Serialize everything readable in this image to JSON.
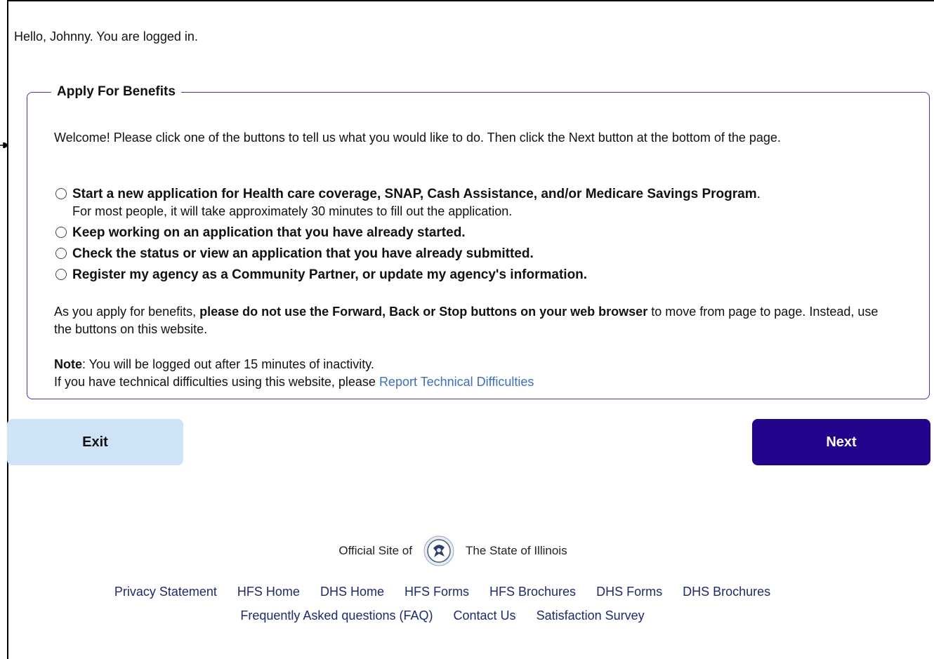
{
  "greeting": "Hello, Johnny. You are logged in.",
  "apply": {
    "legend": "Apply For Benefits",
    "welcome": "Welcome! Please click one of the buttons to tell us what you would like to do. Then click the Next button at the bottom of the page.",
    "options": [
      {
        "label": "Start a new application for Health care coverage, SNAP, Cash Assistance, and/or Medicare Savings Program",
        "suffix": ".",
        "note": "For most people, it will take approximately 30 minutes to fill out the application."
      },
      {
        "label": "Keep working on an application that you have already started."
      },
      {
        "label": "Check the status or view an application that you have already submitted."
      },
      {
        "label": "Register my agency as a Community Partner, or update my agency's information."
      }
    ],
    "warning": {
      "prefix": "As you apply for benefits, ",
      "bold": "please do not use the Forward, Back or Stop buttons on your web browser",
      "suffix": " to move from page to page. Instead, use the buttons on this website."
    },
    "note": {
      "label": "Note",
      "text": ": You will be logged out after 15 minutes of inactivity.",
      "help_prefix": "If you have technical difficulties using this website, please ",
      "help_link": "Report Technical Difficulties"
    }
  },
  "buttons": {
    "exit": "Exit",
    "next": "Next"
  },
  "footer": {
    "official_prefix": "Official Site of",
    "official_suffix": "The State of Illinois",
    "links_row1": [
      "Privacy Statement",
      "HFS Home",
      "DHS Home",
      "HFS Forms",
      "HFS Brochures",
      "DHS Forms",
      "DHS Brochures"
    ],
    "links_row2": [
      "Frequently Asked questions (FAQ)",
      "Contact Us",
      "Satisfaction Survey"
    ]
  },
  "colors": {
    "border": "#3f3aa8",
    "next_bg": "#21038c",
    "exit_bg": "#cfe3f7",
    "link": "#3f6fb8"
  }
}
